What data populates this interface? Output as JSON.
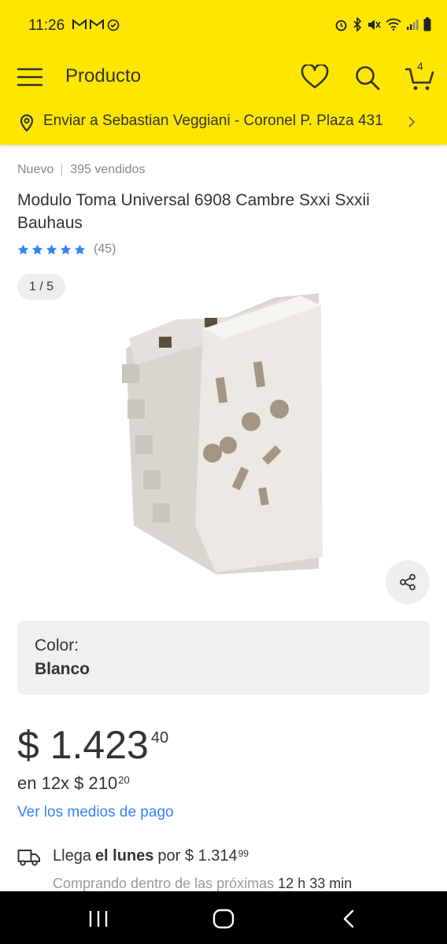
{
  "status_bar": {
    "time": "11:26",
    "left_icons": [
      "gmail-icon",
      "gmail-icon",
      "check-circle-icon"
    ],
    "right_icons": [
      "alarm-icon",
      "bluetooth-icon",
      "mute-icon",
      "wifi-icon",
      "signal-icon",
      "battery-icon"
    ]
  },
  "app_bar": {
    "title": "Producto",
    "cart_count": "4"
  },
  "shipping_bar": {
    "text": "Enviar a Sebastian Veggiani - Coronel P. Plaza 431"
  },
  "product": {
    "condition": "Nuevo",
    "sold": "395 vendidos",
    "title": "Modulo Toma Universal 6908 Cambre Sxxi Sxxii Bauhaus",
    "rating_stars": 5,
    "rating_count": "(45)",
    "image_counter": "1 / 5",
    "color_label": "Color:",
    "color_value": "Blanco",
    "price_main": "$ 1.423",
    "price_cents": "40",
    "installments_text": "en 12x $ 210",
    "installments_cents": "20",
    "payment_link": "Ver los medios de pago"
  },
  "delivery": {
    "prefix": "Llega",
    "day": "el lunes",
    "price_text": "por $ 1.314",
    "price_cents": "99",
    "note": "Comprando dentro de las próximas",
    "note_time": "12 h 33 min"
  },
  "colors": {
    "brand_yellow": "#fee600",
    "link_blue": "#3483fa",
    "star_blue": "#3483fa"
  }
}
